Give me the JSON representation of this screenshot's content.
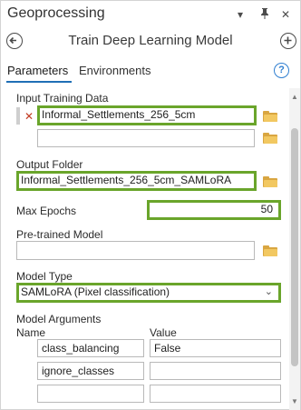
{
  "window": {
    "title": "Geoprocessing",
    "tool_title": "Train Deep Learning Model"
  },
  "tabs": [
    {
      "label": "Parameters",
      "active": true
    },
    {
      "label": "Environments",
      "active": false
    }
  ],
  "params": {
    "input_training_data": {
      "label": "Input Training Data",
      "values": [
        "Informal_Settlements_256_5cm",
        ""
      ]
    },
    "output_folder": {
      "label": "Output Folder",
      "value": "Informal_Settlements_256_5cm_SAMLoRA"
    },
    "max_epochs": {
      "label": "Max Epochs",
      "value": "50"
    },
    "pretrained_model": {
      "label": "Pre-trained Model",
      "value": ""
    },
    "model_type": {
      "label": "Model Type",
      "value": "SAMLoRA (Pixel classification)"
    },
    "model_arguments": {
      "label": "Model Arguments",
      "columns": [
        "Name",
        "Value"
      ],
      "rows": [
        {
          "name": "class_balancing",
          "value": "False"
        },
        {
          "name": "ignore_classes",
          "value": ""
        },
        {
          "name": "",
          "value": ""
        }
      ]
    }
  },
  "icons": {
    "dropdown": "chevron-down-icon",
    "pin": "pin-icon",
    "close": "close-icon",
    "back": "back-arrow-icon",
    "add": "add-icon",
    "help": "help-icon",
    "folder": "folder-icon",
    "error": "error-x-icon"
  },
  "colors": {
    "highlight": "#6aa52b",
    "accent": "#1f6fb6",
    "error": "#c23b22"
  }
}
